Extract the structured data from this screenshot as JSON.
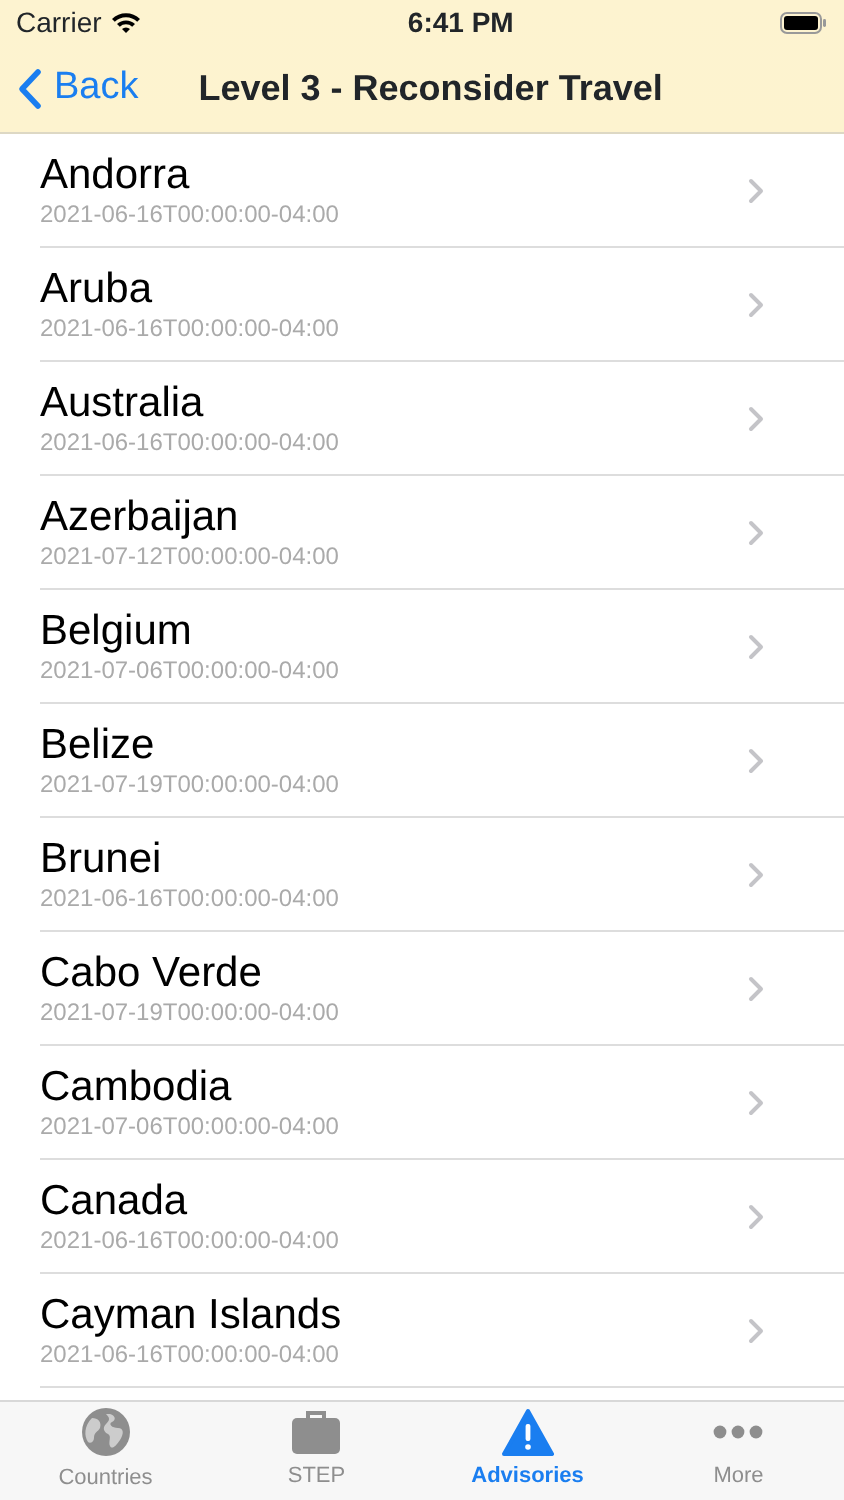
{
  "status_bar": {
    "carrier": "Carrier",
    "time": "6:41 PM"
  },
  "nav_bar": {
    "back": "Back",
    "title": "Level 3 - Reconsider Travel"
  },
  "rows": [
    {
      "name": "Andorra",
      "date": "2021-06-16T00:00:00-04:00"
    },
    {
      "name": "Aruba",
      "date": "2021-06-16T00:00:00-04:00"
    },
    {
      "name": "Australia",
      "date": "2021-06-16T00:00:00-04:00"
    },
    {
      "name": "Azerbaijan",
      "date": "2021-07-12T00:00:00-04:00"
    },
    {
      "name": "Belgium",
      "date": "2021-07-06T00:00:00-04:00"
    },
    {
      "name": "Belize",
      "date": "2021-07-19T00:00:00-04:00"
    },
    {
      "name": "Brunei",
      "date": "2021-06-16T00:00:00-04:00"
    },
    {
      "name": "Cabo Verde",
      "date": "2021-07-19T00:00:00-04:00"
    },
    {
      "name": "Cambodia",
      "date": "2021-07-06T00:00:00-04:00"
    },
    {
      "name": "Canada",
      "date": "2021-06-16T00:00:00-04:00"
    },
    {
      "name": "Cayman Islands",
      "date": "2021-06-16T00:00:00-04:00"
    }
  ],
  "tabs": [
    {
      "label": "Countries",
      "selected": false
    },
    {
      "label": "STEP",
      "selected": false
    },
    {
      "label": "Advisories",
      "selected": true
    },
    {
      "label": "More",
      "selected": false
    }
  ]
}
